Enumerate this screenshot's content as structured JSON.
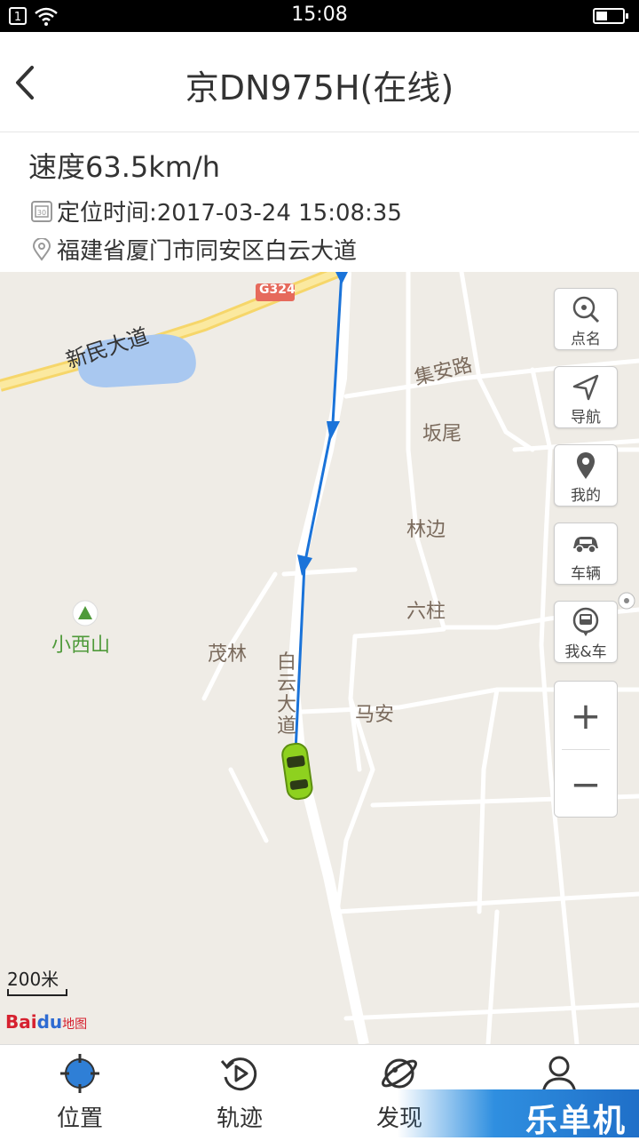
{
  "status_bar": {
    "time": "15:08",
    "sim": "1"
  },
  "header": {
    "title": "京DN975H(在线)"
  },
  "vehicle": {
    "speed": "速度63.5km/h",
    "time": "定位时间:2017-03-24 15:08:35",
    "address": "福建省厦门市同安区白云大道"
  },
  "map": {
    "labels": {
      "xinmin": "新民大道",
      "g324": "G324",
      "jian": "集安路",
      "banwei": "坂尾",
      "linbian": "林边",
      "liuzhu": "六柱",
      "xiaoxishan": "小西山",
      "maolin": "茂林",
      "baiyun": "白云大道",
      "maan": "马安"
    },
    "controls": {
      "roll_call": "点名",
      "navigate": "导航",
      "mine": "我的",
      "vehicle": "车辆",
      "me_and_car": "我&车",
      "zoom_in": "+",
      "zoom_out": "−"
    },
    "scale": "200米",
    "logo_bai": "Bai",
    "logo_du": "du",
    "logo_map": "地图"
  },
  "tabs": {
    "location": "位置",
    "track": "轨迹",
    "discover": "发现"
  },
  "watermark": "乐单机",
  "colors": {
    "route": "#1a73d9",
    "car": "#8ed11f",
    "water": "#a9c8f0"
  }
}
